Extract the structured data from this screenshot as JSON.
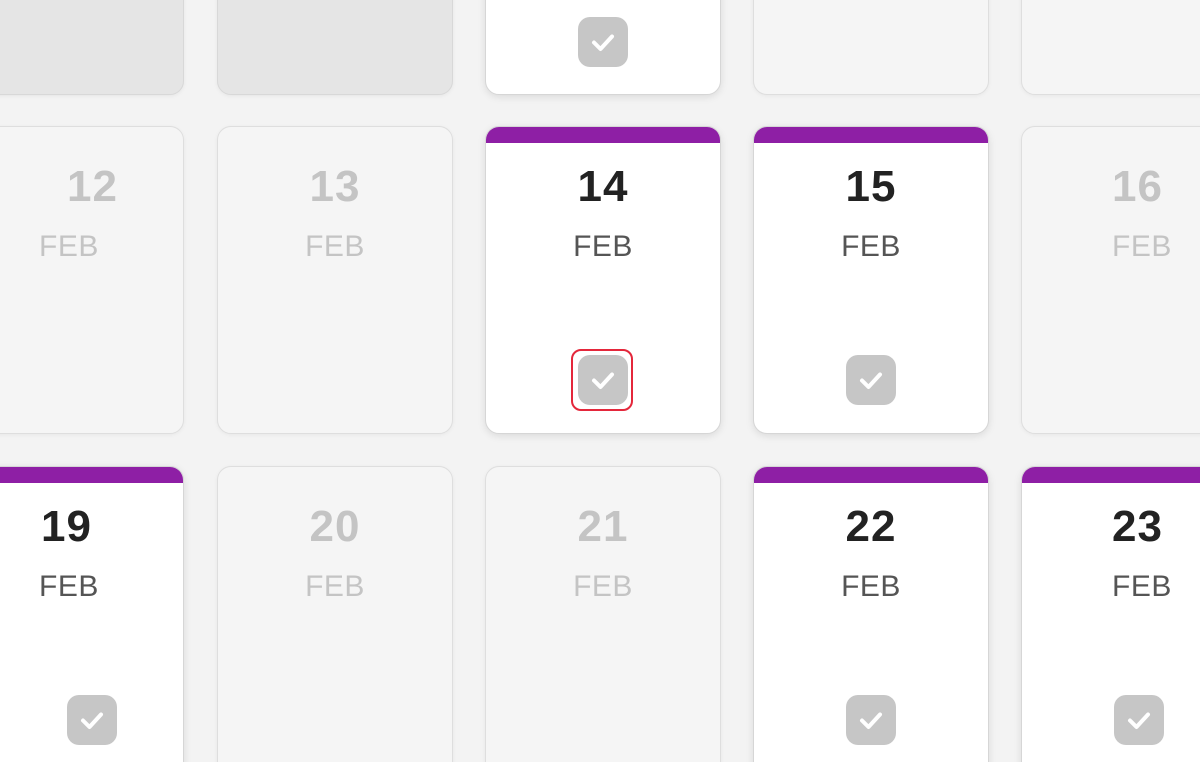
{
  "calendar": {
    "row_top": [
      {
        "day": "",
        "month": "",
        "state": "dark",
        "checked": false
      },
      {
        "day": "",
        "month": "",
        "state": "dark",
        "checked": false
      },
      {
        "day": "",
        "month": "",
        "state": "active",
        "checked": true
      },
      {
        "day": "",
        "month": "",
        "state": "inactive",
        "checked": false
      },
      {
        "day": "",
        "month": "",
        "state": "inactive",
        "checked": false
      }
    ],
    "row_mid": [
      {
        "day": "12",
        "month": "FEB",
        "state": "inactive",
        "accent": false,
        "checked": false
      },
      {
        "day": "13",
        "month": "FEB",
        "state": "inactive",
        "accent": false,
        "checked": false
      },
      {
        "day": "14",
        "month": "FEB",
        "state": "active",
        "accent": true,
        "checked": true,
        "highlighted": true
      },
      {
        "day": "15",
        "month": "FEB",
        "state": "active",
        "accent": true,
        "checked": true
      },
      {
        "day": "16",
        "month": "FEB",
        "state": "inactive",
        "accent": false,
        "checked": false
      }
    ],
    "row_bottom": [
      {
        "day": "19",
        "month": "FEB",
        "state": "active",
        "accent": true,
        "checked": true
      },
      {
        "day": "20",
        "month": "FEB",
        "state": "inactive",
        "accent": false,
        "checked": false
      },
      {
        "day": "21",
        "month": "FEB",
        "state": "inactive",
        "accent": false,
        "checked": false
      },
      {
        "day": "22",
        "month": "FEB",
        "state": "active",
        "accent": true,
        "checked": true
      },
      {
        "day": "23",
        "month": "FEB",
        "state": "active",
        "accent": true,
        "checked": true
      }
    ]
  },
  "icons": {
    "check": "check-icon"
  },
  "colors": {
    "accent": "#8e1fa5",
    "highlight": "#e4273b",
    "check_bg": "#c6c6c6"
  }
}
